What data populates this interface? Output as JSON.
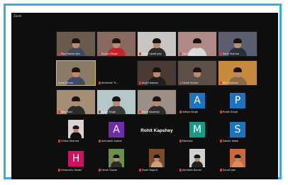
{
  "window": {
    "title": "Zoom"
  },
  "participants": [
    {
      "name": "Ravi Kumar Jha",
      "kind": "video",
      "muted": true,
      "bg": "#6a5a4c",
      "shirt": "#3f4a5c"
    },
    {
      "name": "Shalini Singh",
      "kind": "video",
      "muted": true,
      "bg": "#8a6a60",
      "shirt": "#c2262b"
    },
    {
      "name": "Neha Upadhyay",
      "kind": "video",
      "muted": true,
      "bg": "#c9c5c2",
      "shirt": "#2b2b2b"
    },
    {
      "name": "Samiksha",
      "kind": "video",
      "muted": true,
      "bg": "#b08a86",
      "shirt": "#d9d9d9"
    },
    {
      "name": "Sahil Sharma",
      "kind": "video",
      "muted": true,
      "bg": "#5a5e6e",
      "shirt": "#2a2f3b"
    },
    {
      "name": "Suraj Kumar",
      "kind": "video",
      "muted": false,
      "active": true,
      "bg": "#8b7b66",
      "shirt": "#3b4a66"
    },
    {
      "name": "Abhishek Tr...",
      "kind": "dark",
      "muted": true
    },
    {
      "name": "Anjali Kapoor",
      "kind": "video",
      "muted": true,
      "bg": "#4a3a34",
      "shirt": "#1f1f1f"
    },
    {
      "name": "Harsh Kumar",
      "kind": "video",
      "muted": true,
      "bg": "#5d5048",
      "shirt": "#5a4f46"
    },
    {
      "name": "Kirti Saxena",
      "kind": "video",
      "muted": true,
      "bg": "#c58a3c",
      "shirt": "#8b6a4a"
    },
    {
      "name": "Ritu Rani",
      "kind": "video",
      "muted": true,
      "bg": "#a58f74",
      "shirt": "#2b2b2b"
    },
    {
      "name": "Arjun Singh",
      "kind": "video",
      "muted": true,
      "bg": "#b5c7c9",
      "shirt": "#3a3a3a"
    },
    {
      "name": "Rohit Kapshey",
      "kind": "video",
      "muted": true,
      "bg": "#9c8f86",
      "shirt": "#2c2c2c"
    },
    {
      "name": "Aditya Singh",
      "kind": "letter",
      "letter": "A",
      "color": "#1e73be",
      "muted": true
    },
    {
      "name": "Pratik Singh",
      "kind": "letter",
      "letter": "P",
      "color": "#1e73be",
      "muted": true
    },
    {
      "name": "Chitra Sharma",
      "kind": "video-small",
      "muted": true,
      "bg": "#d9d4d2",
      "shirt": "#111111"
    },
    {
      "name": "Ashutosh Anand",
      "kind": "letter",
      "letter": "A",
      "color": "#6f2da8",
      "muted": true
    },
    {
      "name": "Rohit Kapshey",
      "kind": "name",
      "muted": false
    },
    {
      "name": "Manisha",
      "kind": "letter",
      "letter": "M",
      "color": "#169b8a",
      "muted": true
    },
    {
      "name": "Sakshi Vatsh",
      "kind": "letter",
      "letter": "S",
      "color": "#1e73be",
      "muted": true
    },
    {
      "name": "Himanshu Yadav",
      "kind": "letter",
      "letter": "H",
      "color": "#d3105f",
      "muted": true
    },
    {
      "name": "Harsh Gupta",
      "kind": "video-small",
      "muted": true,
      "bg": "#6b8f4c",
      "shirt": "#2c2c2c"
    },
    {
      "name": "Swati Rajput",
      "kind": "video-small",
      "muted": true,
      "bg": "#7b4a28",
      "shirt": "#cfa077"
    },
    {
      "name": "Akhilesh Kumar",
      "kind": "video-small",
      "muted": true,
      "bg": "#d1d1d1",
      "shirt": "#222222"
    },
    {
      "name": "Sonali Jain",
      "kind": "video-small",
      "muted": true,
      "bg": "#c9683a",
      "shirt": "#e38a56"
    }
  ]
}
